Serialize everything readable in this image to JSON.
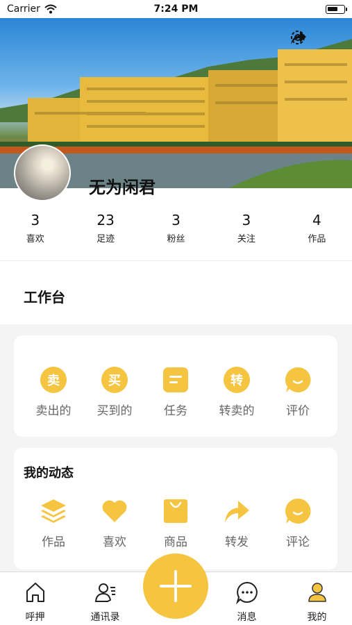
{
  "status_bar": {
    "carrier": "Carrier",
    "time": "7:24 PM"
  },
  "profile": {
    "username": "无为闲君"
  },
  "stats": [
    {
      "value": "3",
      "label": "喜欢"
    },
    {
      "value": "23",
      "label": "足迹"
    },
    {
      "value": "3",
      "label": "粉丝"
    },
    {
      "value": "3",
      "label": "关注"
    },
    {
      "value": "4",
      "label": "作品"
    }
  ],
  "workspace": {
    "title": "工作台"
  },
  "orders": [
    {
      "label": "卖出的",
      "icon": "sell-icon",
      "glyph": "卖"
    },
    {
      "label": "买到的",
      "icon": "buy-icon",
      "glyph": "买"
    },
    {
      "label": "任务",
      "icon": "task-icon"
    },
    {
      "label": "转卖的",
      "icon": "resell-icon",
      "glyph": "转"
    },
    {
      "label": "评价",
      "icon": "review-icon"
    }
  ],
  "dynamics": {
    "title": "我的动态",
    "items": [
      {
        "label": "作品",
        "icon": "layers-icon"
      },
      {
        "label": "喜欢",
        "icon": "heart-icon"
      },
      {
        "label": "商品",
        "icon": "shopping-bag-icon"
      },
      {
        "label": "转发",
        "icon": "forward-icon"
      },
      {
        "label": "评论",
        "icon": "comment-icon"
      }
    ]
  },
  "tabbar": [
    {
      "label": "呼押",
      "icon": "home-icon"
    },
    {
      "label": "通讯录",
      "icon": "contacts-icon"
    },
    {
      "label": "消息",
      "icon": "message-icon"
    },
    {
      "label": "我的",
      "icon": "profile-icon"
    }
  ],
  "colors": {
    "accent": "#f5c542",
    "accent_dark": "#f2b90f"
  }
}
